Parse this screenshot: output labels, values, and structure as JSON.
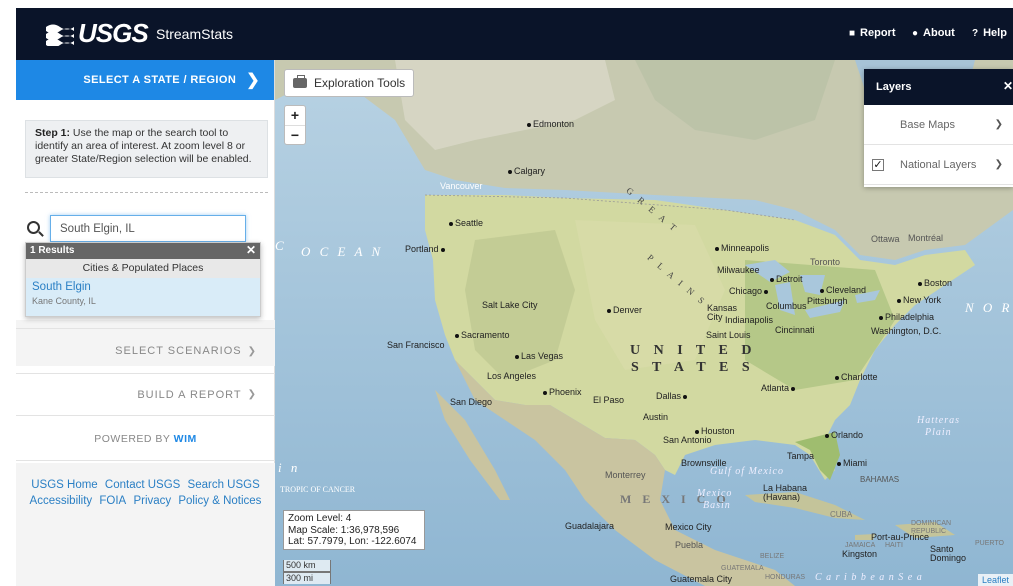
{
  "header": {
    "logo": "USGS",
    "app_name": "StreamStats",
    "links": [
      {
        "icon": "bookmark-icon",
        "label": "Report"
      },
      {
        "icon": "info-icon",
        "label": "About"
      },
      {
        "icon": "question-icon",
        "label": "Help"
      }
    ]
  },
  "sidebar": {
    "select_state": "SELECT A STATE / REGION",
    "step_label": "Step 1:",
    "step_text": " Use the map or the search tool to identify an area of interest. At zoom level 8 or greater State/Region selection will be enabled.",
    "search_value": "South Elgin, IL",
    "results_count": "1 Results",
    "results_category": "Cities & Populated Places",
    "result_name": "South Elgin",
    "result_sub": "Kane County, IL",
    "select_scenarios": "SELECT SCENARIOS",
    "build_report": "BUILD A REPORT",
    "powered_by": "POWERED BY",
    "wim": "WIM",
    "footer_links": [
      "USGS Home",
      "Contact USGS",
      "Search USGS",
      "Accessibility",
      "FOIA",
      "Privacy",
      "Policy & Notices"
    ]
  },
  "map": {
    "exploration_tools": "Exploration Tools",
    "zoom_in": "+",
    "zoom_out": "−",
    "layers_title": "Layers",
    "base_maps": "Base Maps",
    "national_layers": "National Layers",
    "zoom_level": "Zoom Level: 4",
    "map_scale": "Map Scale: 1:36,978,596",
    "lat_lon": "Lat: 57.7979, Lon: -122.6074",
    "scale_km": "500 km",
    "scale_mi": "300 mi",
    "attribution": "Leaflet",
    "labels": {
      "edmonton": "Edmonton",
      "calgary": "Calgary",
      "vancouver": "Vancouver",
      "seattle": "Seattle",
      "portland": "Portland",
      "ocean": "O C E A N",
      "great_plains_1": "G R E A T",
      "great_plains_2": "P L A I N S",
      "minneapolis": "Minneapolis",
      "ottawa": "Ottawa",
      "montreal": "Montréal",
      "toronto": "Toronto",
      "milwaukee": "Milwaukee",
      "detroit": "Detroit",
      "chicago": "Chicago",
      "cleveland": "Cleveland",
      "boston": "Boston",
      "newyork": "New York",
      "pittsburgh": "Pittsburgh",
      "philadelphia": "Philadelphia",
      "washington": "Washington, D.C.",
      "columbus": "Columbus",
      "indianapolis": "Indianapolis",
      "cincinnati": "Cincinnati",
      "kansascity": "Kansas City",
      "saintlouis": "Saint Louis",
      "denver": "Denver",
      "saltlake": "Salt Lake City",
      "sacramento": "Sacramento",
      "sanfrancisco": "San Francisco",
      "lasvegas": "Las Vegas",
      "losangeles": "Los Angeles",
      "sandiego": "San Diego",
      "phoenix": "Phoenix",
      "elpaso": "El Paso",
      "dallas": "Dallas",
      "austin": "Austin",
      "houston": "Houston",
      "sanantonio": "San Antonio",
      "atlanta": "Atlanta",
      "charlotte": "Charlotte",
      "orlando": "Orlando",
      "tampa": "Tampa",
      "miami": "Miami",
      "brownsville": "Brownsville",
      "monterrey": "Monterrey",
      "mexico": "M E X I C O",
      "mexicobasin1": "Mexico",
      "mexicobasin2": "Basin",
      "gulf": "Gulf  of  Mexico",
      "lahabana": "La Habana",
      "havana": "(Havana)",
      "bahamas": "BAHAMAS",
      "cuba": "CUBA",
      "guadalajara": "Guadalajara",
      "mexicocity": "Mexico City",
      "puebla": "Puebla",
      "belize": "BELIZE",
      "guatemala": "GUATEMALA",
      "guatemalacity": "Guatemala City",
      "honduras": "HONDURAS",
      "caribbean": "C a r i b b e a n   S e a",
      "portauprince": "Port-au-Prince",
      "haiti": "HAITI",
      "jamaica": "JAMAICA",
      "kingston": "Kingston",
      "dominican": "DOMINICAN REPUBLIC",
      "santodomingo": "Santo Domingo",
      "puerto": "PUERTO",
      "hatteras": "Hatteras",
      "plain": "Plain",
      "tropic": "TROPIC OF CANCER",
      "united": "U N I T E D",
      "states": "S T A T E S",
      "nor": "N O R",
      "c_edge": "C",
      "in_edge": "i n"
    }
  },
  "colors": {
    "header_bg": "#0a1429",
    "accent": "#1e88e5",
    "link": "#2a7fc4"
  }
}
